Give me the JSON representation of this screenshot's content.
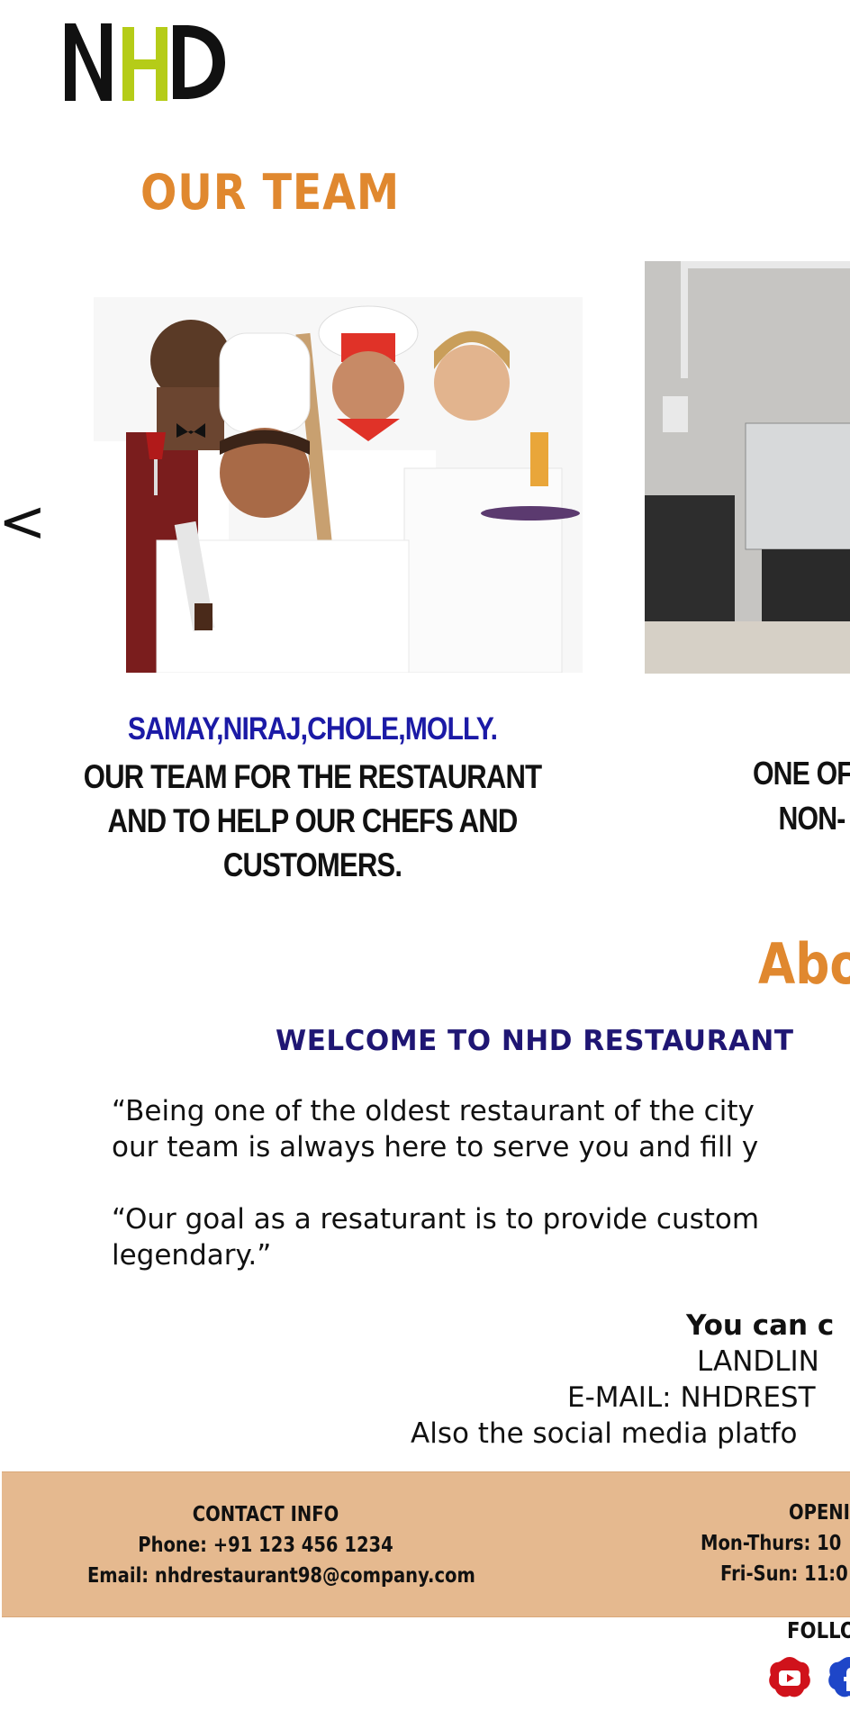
{
  "brand": {
    "logo_text": "NHD",
    "logo_colors": {
      "n": "#111111",
      "h": "#B5CC18",
      "d": "#111111"
    }
  },
  "team": {
    "title": "OUR TEAM",
    "prev_arrow": "<",
    "slides": [
      {
        "image": "restaurant-staff-group-photo",
        "names": "SAMAY,NIRAJ,CHOLE,MOLLY.",
        "description_lines": [
          "OUR TEAM FOR THE RESTAURANT",
          "AND TO HELP OUR CHEFS AND",
          "CUSTOMERS."
        ]
      },
      {
        "image": "coffee-machine-photo",
        "description_lines": [
          "ONE OF",
          "NON-"
        ]
      }
    ]
  },
  "about": {
    "title": "Abo",
    "welcome": "WELCOME TO NHD RESTAURANT",
    "paragraph1_lines": [
      "“Being one of the oldest restaurant of the city",
      "our team is always here to serve you and fill y"
    ],
    "paragraph2_lines": [
      "“Our goal as a resaturant is to provide custom",
      "legendary.”"
    ],
    "contact_lines": [
      "You can c",
      "LANDLIN",
      "E-MAIL: NHDREST",
      "Also the social media platfo"
    ]
  },
  "footer": {
    "contact_info": {
      "heading": "CONTACT INFO",
      "phone": "Phone: +91 123 456 1234",
      "email": "Email: nhdrestaurant98@company.com"
    },
    "opening": {
      "heading": "OPENI",
      "line1": "Mon-Thurs: 10",
      "line2": "Fri-Sun: 11:0"
    },
    "follow": "FOLLO",
    "social_icons": [
      "youtube-icon",
      "facebook-icon"
    ]
  },
  "colors": {
    "accent_orange": "#E0882F",
    "names_blue": "#1B1AA6",
    "welcome_navy": "#1F1673",
    "footer_band": "#E5B98F"
  }
}
